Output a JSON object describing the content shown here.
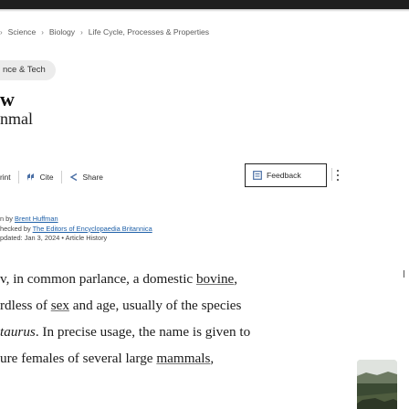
{
  "breadcrumb": {
    "items": [
      "Science",
      "Biology",
      "Life Cycle, Processes & Properties"
    ]
  },
  "category": "nce & Tech",
  "article": {
    "title": "w",
    "subtitle": "nmal"
  },
  "toolbar": {
    "print_label": "rint",
    "cite_label": "Cite",
    "share_label": "Share",
    "feedback_label": "Feedback"
  },
  "meta": {
    "author_prefix": "n by",
    "author": "Brent Huffman",
    "checked_prefix": "hecked by",
    "checked_by": "The Editors of Encyclopaedia Britannica",
    "updated": "pdated: Jan 3, 2024",
    "history_sep": "•",
    "history": "Article History"
  },
  "body": {
    "line1_pre": "v, in common parlance, a domestic ",
    "line1_link": "bovine",
    "line1_post": ",",
    "line2_pre": "rdless of ",
    "line2_link": "sex",
    "line2_post": " and age, usually of the species",
    "line3_em": "taurus",
    "line3_post": ". In precise usage, the name is given to",
    "line4_pre": "ure females of several large ",
    "line4_link": "mammals",
    "line4_post": ","
  },
  "colors": {
    "topbar": "#1f1f1f",
    "link": "#1d5fa8",
    "pill": "#ececec"
  },
  "icons": [
    "chevron-right-icon",
    "cite-icon",
    "share-icon",
    "feedback-icon",
    "more-icon"
  ]
}
